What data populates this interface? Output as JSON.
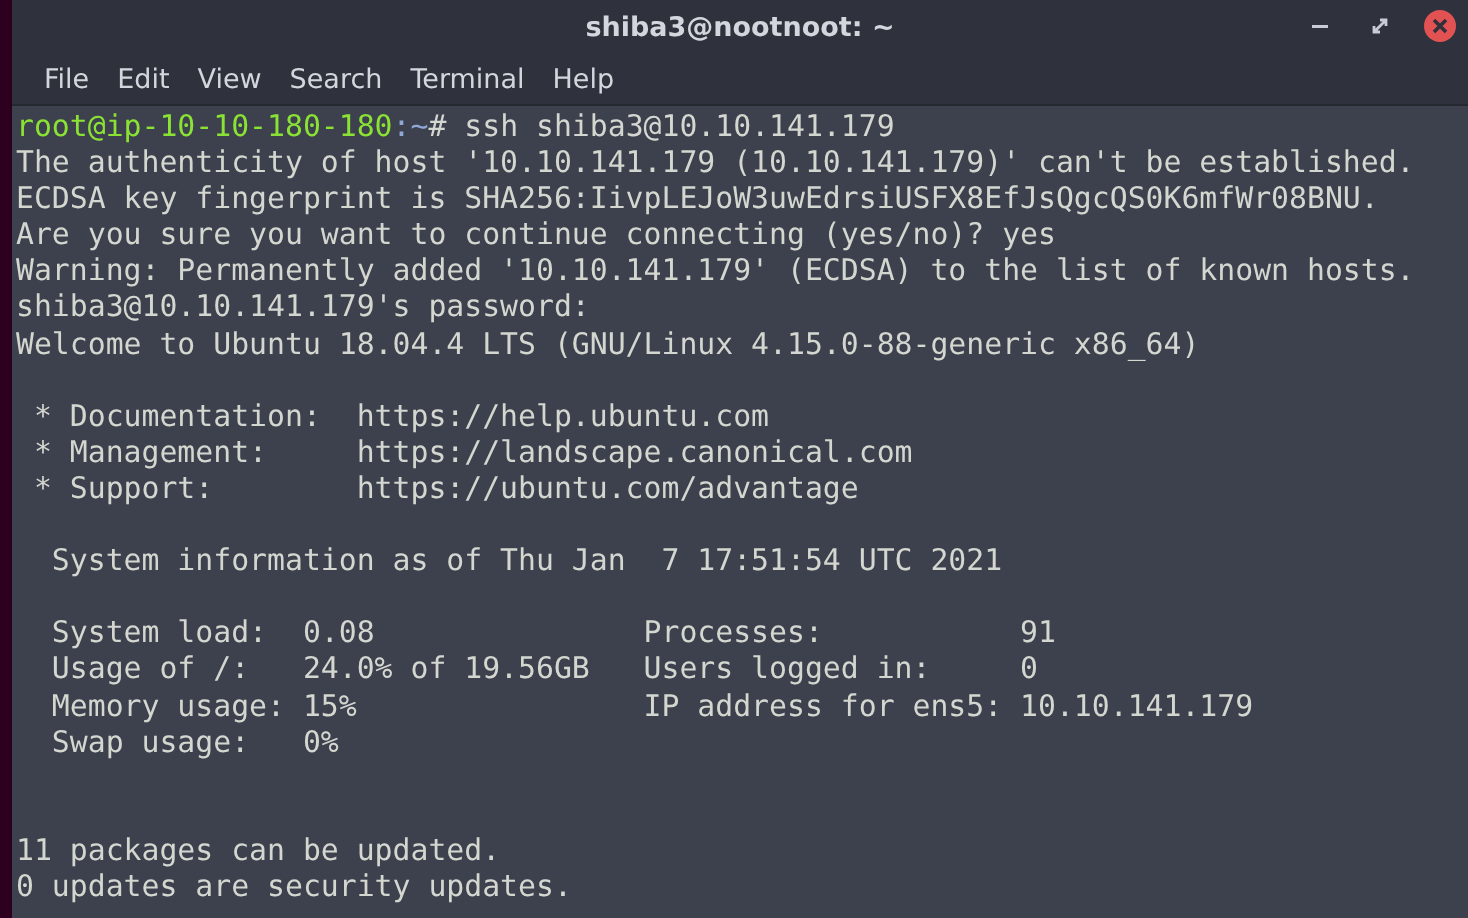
{
  "window": {
    "title": "shiba3@nootnoot: ~"
  },
  "menu": [
    "File",
    "Edit",
    "View",
    "Search",
    "Terminal",
    "Help"
  ],
  "terminal": {
    "lines": [
      {
        "kind": "prompt",
        "user_host": "root@ip-10-10-180-180",
        "path": ":~",
        "command": "# ssh shiba3@10.10.141.179"
      },
      {
        "kind": "output",
        "text": "The authenticity of host '10.10.141.179 (10.10.141.179)' can't be established."
      },
      {
        "kind": "output",
        "text": "ECDSA key fingerprint is SHA256:IivpLEJoW3uwEdrsiUSFX8EfJsQgcQS0K6mfWr08BNU."
      },
      {
        "kind": "output",
        "text": "Are you sure you want to continue connecting (yes/no)? yes"
      },
      {
        "kind": "output",
        "text": "Warning: Permanently added '10.10.141.179' (ECDSA) to the list of known hosts."
      },
      {
        "kind": "output",
        "text": "shiba3@10.10.141.179's password:"
      },
      {
        "kind": "output",
        "text": "Welcome to Ubuntu 18.04.4 LTS (GNU/Linux 4.15.0-88-generic x86_64)"
      },
      {
        "kind": "blank"
      },
      {
        "kind": "output",
        "text": " * Documentation:  https://help.ubuntu.com"
      },
      {
        "kind": "output",
        "text": " * Management:     https://landscape.canonical.com"
      },
      {
        "kind": "output",
        "text": " * Support:        https://ubuntu.com/advantage"
      },
      {
        "kind": "blank"
      },
      {
        "kind": "output",
        "text": "  System information as of Thu Jan  7 17:51:54 UTC 2021"
      },
      {
        "kind": "blank"
      },
      {
        "kind": "output",
        "text": "  System load:  0.08               Processes:           91"
      },
      {
        "kind": "output",
        "text": "  Usage of /:   24.0% of 19.56GB   Users logged in:     0"
      },
      {
        "kind": "output",
        "text": "  Memory usage: 15%                IP address for ens5: 10.10.141.179"
      },
      {
        "kind": "output",
        "text": "  Swap usage:   0%"
      },
      {
        "kind": "blank"
      },
      {
        "kind": "blank"
      },
      {
        "kind": "output",
        "text": "11 packages can be updated."
      },
      {
        "kind": "output",
        "text": "0 updates are security updates."
      }
    ]
  }
}
